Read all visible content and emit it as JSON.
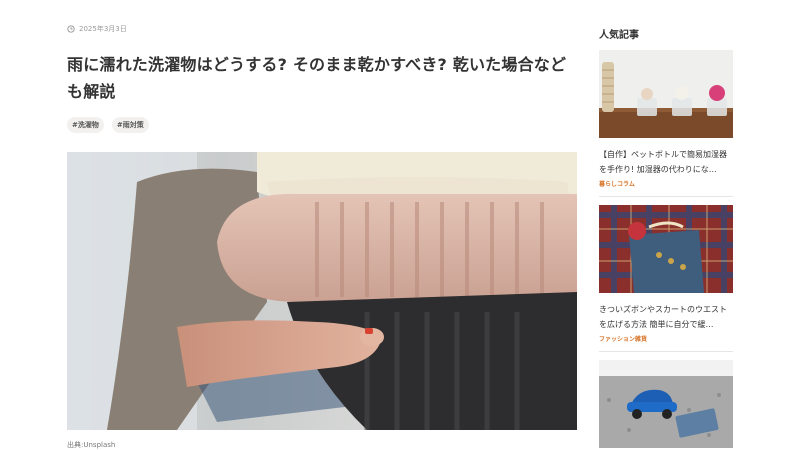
{
  "article": {
    "date": "2025年3月3日",
    "title": "雨に濡れた洗濯物はどうする? そのまま乾かすべき? 乾いた場合なども解説",
    "tags": [
      "#洗濯物",
      "#雨対策"
    ],
    "hero_icon": "knit-sweaters-photo",
    "caption": "出典:Unsplash"
  },
  "sidebar": {
    "heading": "人気記事",
    "items": [
      {
        "title": "【自作】ペットボトルで簡易加湿器を手作り! 加湿器の代わりにな…",
        "category": "暮らしコラム",
        "thumb_icon": "bottle-humidifier-photo"
      },
      {
        "title": "きついズボンやスカートのウエストを広げる方法 簡単に自分で緩…",
        "category": "ファッション雑貨",
        "thumb_icon": "denim-plaid-photo"
      },
      {
        "title": "",
        "category": "",
        "thumb_icon": "blue-toy-car-photo"
      }
    ]
  },
  "colors": {
    "accent": "#d9752b",
    "tag_bg": "#f3f1ef"
  }
}
